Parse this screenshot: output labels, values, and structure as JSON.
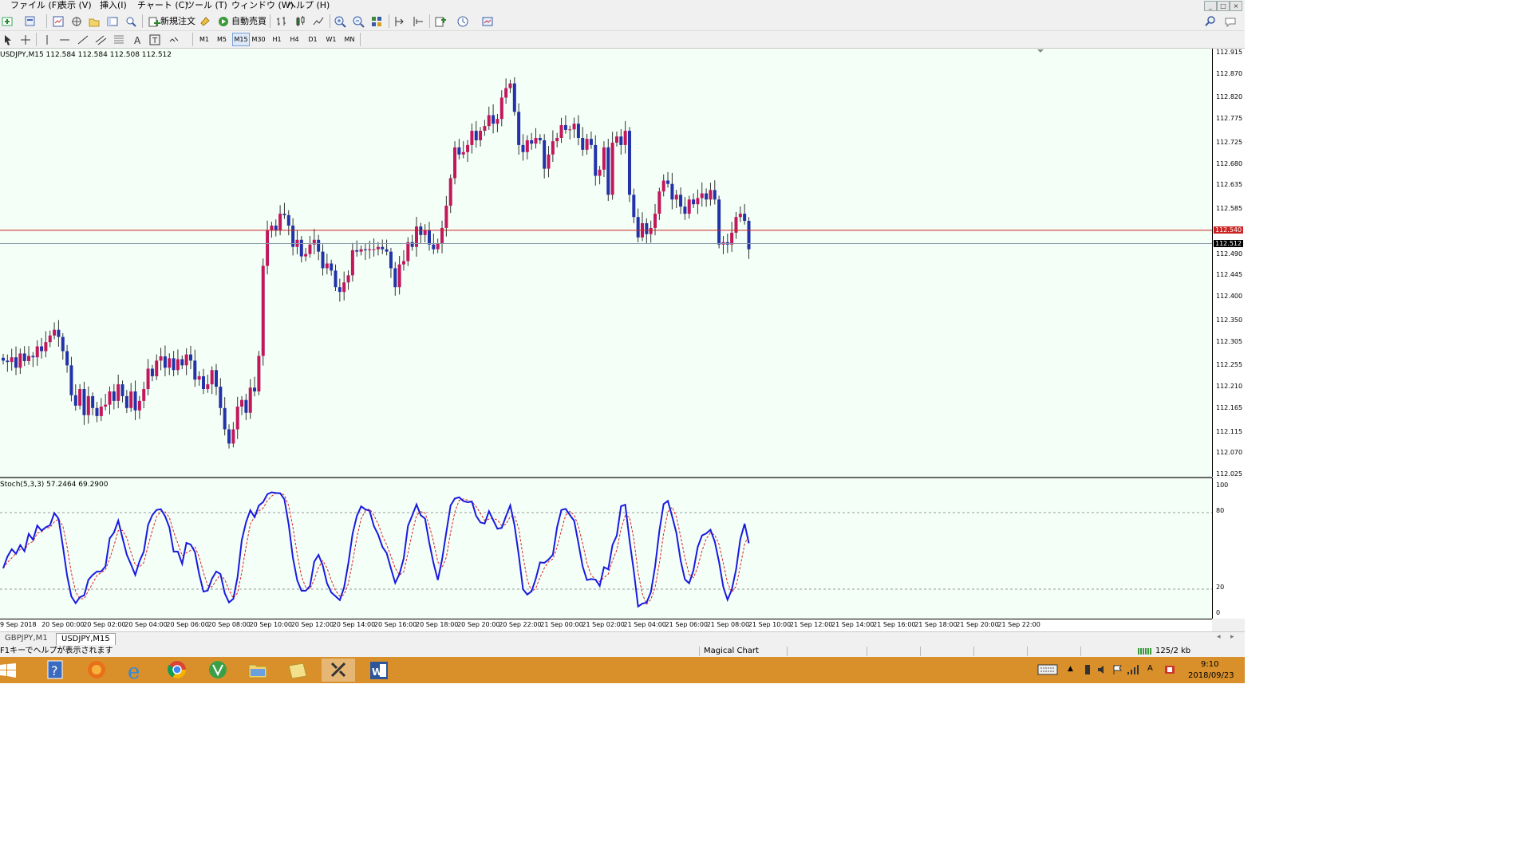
{
  "menu": {
    "items": [
      "ファイル (F)",
      "表示 (V)",
      "挿入(I)",
      "チャート (C)",
      "ツール (T)",
      "ウィンドウ (W)",
      "ヘルプ (H)"
    ]
  },
  "toolbar": {
    "new_order": "新規注文",
    "autotrade": "自動売買",
    "timeframes": [
      "M1",
      "M5",
      "M15",
      "M30",
      "H1",
      "H4",
      "D1",
      "W1",
      "MN"
    ],
    "active_timeframe": "M15",
    "window_buttons": [
      "_",
      "□",
      "×"
    ]
  },
  "chart": {
    "title": "USDJPY,M15  112.584 112.584 112.508 112.512",
    "price_ticks": [
      "112.915",
      "112.870",
      "112.820",
      "112.775",
      "112.725",
      "112.680",
      "112.635",
      "112.585",
      "112.540",
      "112.490",
      "112.445",
      "112.400",
      "112.350",
      "112.305",
      "112.255",
      "112.210",
      "112.165",
      "112.115",
      "112.070",
      "112.025"
    ],
    "ask_line": "112.540",
    "bid_line": "112.512",
    "indicator_title": "Stoch(5,3,3) 57.2464 69.2900",
    "stoch_ticks": [
      "100",
      "80",
      "20",
      "0"
    ],
    "time_labels": [
      "9 Sep 2018",
      "20 Sep 00:00",
      "20 Sep 02:00",
      "20 Sep 04:00",
      "20 Sep 06:00",
      "20 Sep 08:00",
      "20 Sep 10:00",
      "20 Sep 12:00",
      "20 Sep 14:00",
      "20 Sep 16:00",
      "20 Sep 18:00",
      "20 Sep 20:00",
      "20 Sep 22:00",
      "21 Sep 00:00",
      "21 Sep 02:00",
      "21 Sep 04:00",
      "21 Sep 06:00",
      "21 Sep 08:00",
      "21 Sep 10:00",
      "21 Sep 12:00",
      "21 Sep 14:00",
      "21 Sep 16:00",
      "21 Sep 18:00",
      "21 Sep 20:00",
      "21 Sep 22:00"
    ],
    "colors": {
      "bull": "#c2185b",
      "bear": "#2233aa",
      "ask": "#cc2222",
      "bid": "#8899aa",
      "stoch_main": "#1a1adf",
      "stoch_signal": "#dd2222"
    }
  },
  "tabs": {
    "items": [
      "GBPJPY,M1",
      "USDJPY,M15"
    ],
    "active": "USDJPY,M15"
  },
  "status": {
    "help": "F1キーでヘルプが表示されます",
    "profile": "Magical Chart",
    "traffic": "125/2 kb"
  },
  "taskbar": {
    "time": "9:10",
    "date": "2018/09/23",
    "apps": [
      "help-app",
      "firefox",
      "internet-explorer",
      "chrome",
      "app-green",
      "file-explorer",
      "folder",
      "metatrader",
      "word"
    ]
  },
  "chart_data": {
    "type": "candlestick",
    "symbol": "USDJPY",
    "timeframe": "M15",
    "close": [
      112.265,
      112.262,
      112.272,
      112.25,
      112.28,
      112.264,
      112.275,
      112.272,
      112.295,
      112.285,
      112.304,
      112.318,
      112.33,
      112.315,
      112.285,
      112.255,
      112.192,
      112.17,
      112.205,
      112.15,
      112.19,
      112.165,
      112.148,
      112.168,
      112.172,
      112.2,
      112.18,
      112.215,
      112.19,
      112.165,
      112.2,
      112.16,
      112.18,
      112.205,
      112.248,
      112.232,
      112.265,
      112.274,
      112.25,
      112.27,
      112.245,
      112.268,
      112.255,
      112.278,
      112.265,
      112.225,
      112.232,
      112.205,
      112.215,
      112.245,
      112.21,
      112.165,
      112.12,
      112.09,
      112.12,
      112.168,
      112.182,
      112.155,
      112.208,
      112.2,
      112.275,
      112.465,
      112.54,
      112.55,
      112.54,
      112.575,
      112.572,
      112.55,
      112.505,
      112.52,
      112.485,
      112.49,
      112.51,
      112.52,
      112.495,
      112.46,
      112.47,
      112.455,
      112.42,
      112.41,
      112.43,
      112.445,
      112.498,
      112.495,
      112.5,
      112.498,
      112.5,
      112.5,
      112.505,
      112.5,
      112.495,
      112.46,
      112.42,
      112.468,
      112.475,
      112.515,
      112.505,
      112.548,
      112.53,
      112.54,
      112.51,
      112.5,
      112.512,
      112.545,
      112.592,
      112.65,
      112.715,
      112.7,
      112.705,
      112.72,
      112.75,
      112.73,
      112.75,
      112.76,
      112.783,
      112.765,
      112.775,
      112.82,
      112.84,
      112.85,
      112.79,
      112.72,
      112.705,
      112.73,
      112.723,
      112.735,
      112.73,
      112.67,
      112.7,
      112.728,
      112.735,
      112.762,
      112.752,
      112.753,
      112.765,
      112.735,
      112.71,
      112.733,
      112.72,
      112.655,
      112.668,
      112.715,
      112.615,
      112.725,
      112.738,
      112.72,
      112.75,
      112.615,
      112.568,
      112.525,
      112.555,
      112.532,
      112.545,
      112.575,
      112.622,
      112.645,
      112.638,
      112.605,
      112.615,
      112.59,
      112.575,
      112.605,
      112.595,
      112.608,
      112.618,
      112.605,
      112.625,
      112.605,
      112.51,
      112.515,
      112.51,
      112.535,
      112.568,
      112.575,
      112.56,
      112.5
    ],
    "ylim": [
      112.025,
      112.915
    ],
    "x_range": [
      "9 Sep 2018",
      "21 Sep 22:00"
    ],
    "stochastic": {
      "name": "Stoch(5,3,3)",
      "main_last": 57.2464,
      "signal_last": 69.29,
      "ylim": [
        0,
        100
      ],
      "levels": [
        20,
        80
      ]
    }
  }
}
